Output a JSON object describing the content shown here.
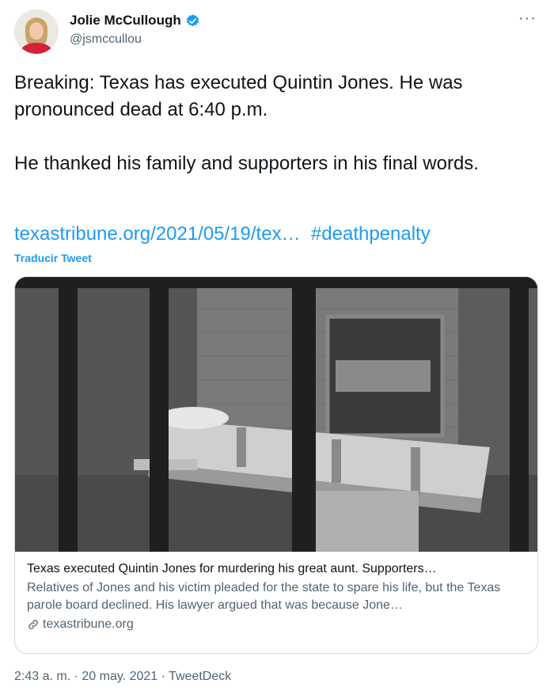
{
  "author": {
    "name": "Jolie McCullough",
    "handle": "@jsmccullou",
    "avatar_icon": "person-avatar",
    "verified_icon": "verified-badge-icon",
    "verified_color": "#1d9bf0"
  },
  "more_icon": "more-horizontal-icon",
  "tweet": {
    "text": "Breaking: Texas has executed Quintin Jones. He was pronounced dead at 6:40 p.m.\n\nHe thanked his family and supporters in his final words.",
    "link_text": "texastribune.org/2021/05/19/tex…",
    "hashtag": "#deathpenalty",
    "translate_label": "Traducir Tweet"
  },
  "card": {
    "image_icon": "execution-chamber-photo",
    "title": "Texas executed Quintin Jones for murdering his great aunt. Supporters…",
    "description": "Relatives of Jones and his victim pleaded for the state to spare his life, but the Texas parole board declined. His lawyer argued that was because Jone…",
    "domain": "texastribune.org",
    "domain_icon": "link-icon"
  },
  "meta": {
    "time": "2:43 a. m.",
    "date": "20 may. 2021",
    "source": "TweetDeck",
    "separator": "·"
  },
  "colors": {
    "link": "#1d9bf0",
    "text": "#0f1419",
    "secondary": "#536471",
    "border": "#cfd9de"
  }
}
